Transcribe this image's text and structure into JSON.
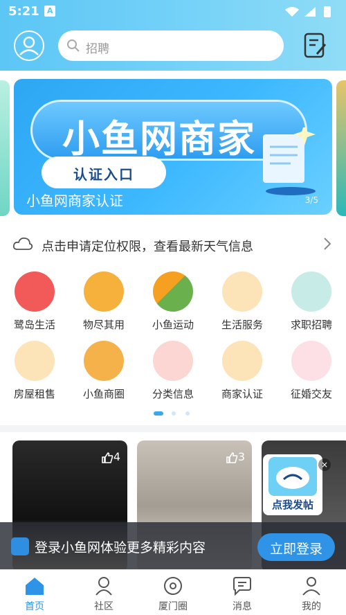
{
  "status": {
    "time": "5:21",
    "app_badge": "A"
  },
  "header": {
    "search_placeholder": "招聘"
  },
  "banner": {
    "title": "小鱼网商家",
    "button": "认证入口",
    "caption": "小鱼网商家认证",
    "pager": "3/5"
  },
  "weather": {
    "text": "点击申请定位权限，查看最新天气信息"
  },
  "grid": {
    "row1": [
      "鹭岛生活",
      "物尽其用",
      "小鱼运动",
      "生活服务",
      "求职招聘"
    ],
    "row2": [
      "房屋租售",
      "小鱼商圈",
      "分类信息",
      "商家认证",
      "征婚交友"
    ]
  },
  "feed": {
    "likes": [
      "4",
      "3"
    ],
    "post_button": "点我发帖"
  },
  "login_prompt": {
    "text": "登录小鱼网体验更多精彩内容",
    "button": "立即登录"
  },
  "bottom_nav": [
    "首页",
    "社区",
    "厦门圈",
    "消息",
    "我的"
  ],
  "colors": {
    "accent": "#2f94e8",
    "header": "#5cc6f5"
  }
}
